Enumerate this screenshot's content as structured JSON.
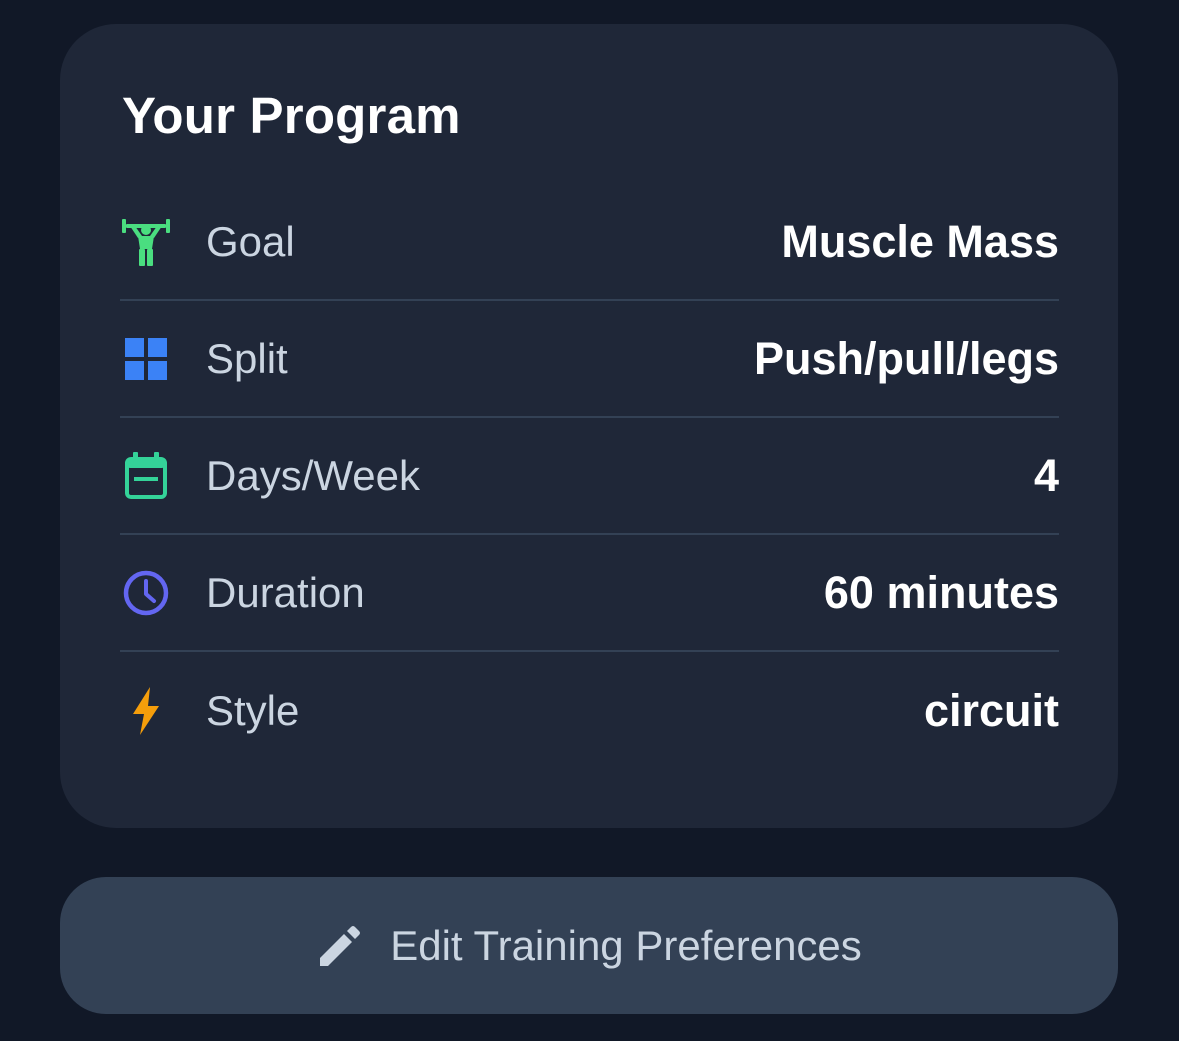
{
  "program": {
    "title": "Your Program",
    "rows": [
      {
        "icon": "weightlifter-icon",
        "label": "Goal",
        "value": "Muscle Mass",
        "color": "#4ade80"
      },
      {
        "icon": "grid-icon",
        "label": "Split",
        "value": "Push/pull/legs",
        "color": "#3b82f6"
      },
      {
        "icon": "calendar-icon",
        "label": "Days/Week",
        "value": "4",
        "color": "#34d399"
      },
      {
        "icon": "clock-icon",
        "label": "Duration",
        "value": "60 minutes",
        "color": "#6366f1"
      },
      {
        "icon": "lightning-icon",
        "label": "Style",
        "value": "circuit",
        "color": "#f59e0b"
      }
    ]
  },
  "edit_button": {
    "icon": "pencil-icon",
    "label": "Edit Training Preferences"
  },
  "colors": {
    "background": "#111827",
    "card": "#1f2738",
    "button": "#334155",
    "divider": "#334155"
  }
}
